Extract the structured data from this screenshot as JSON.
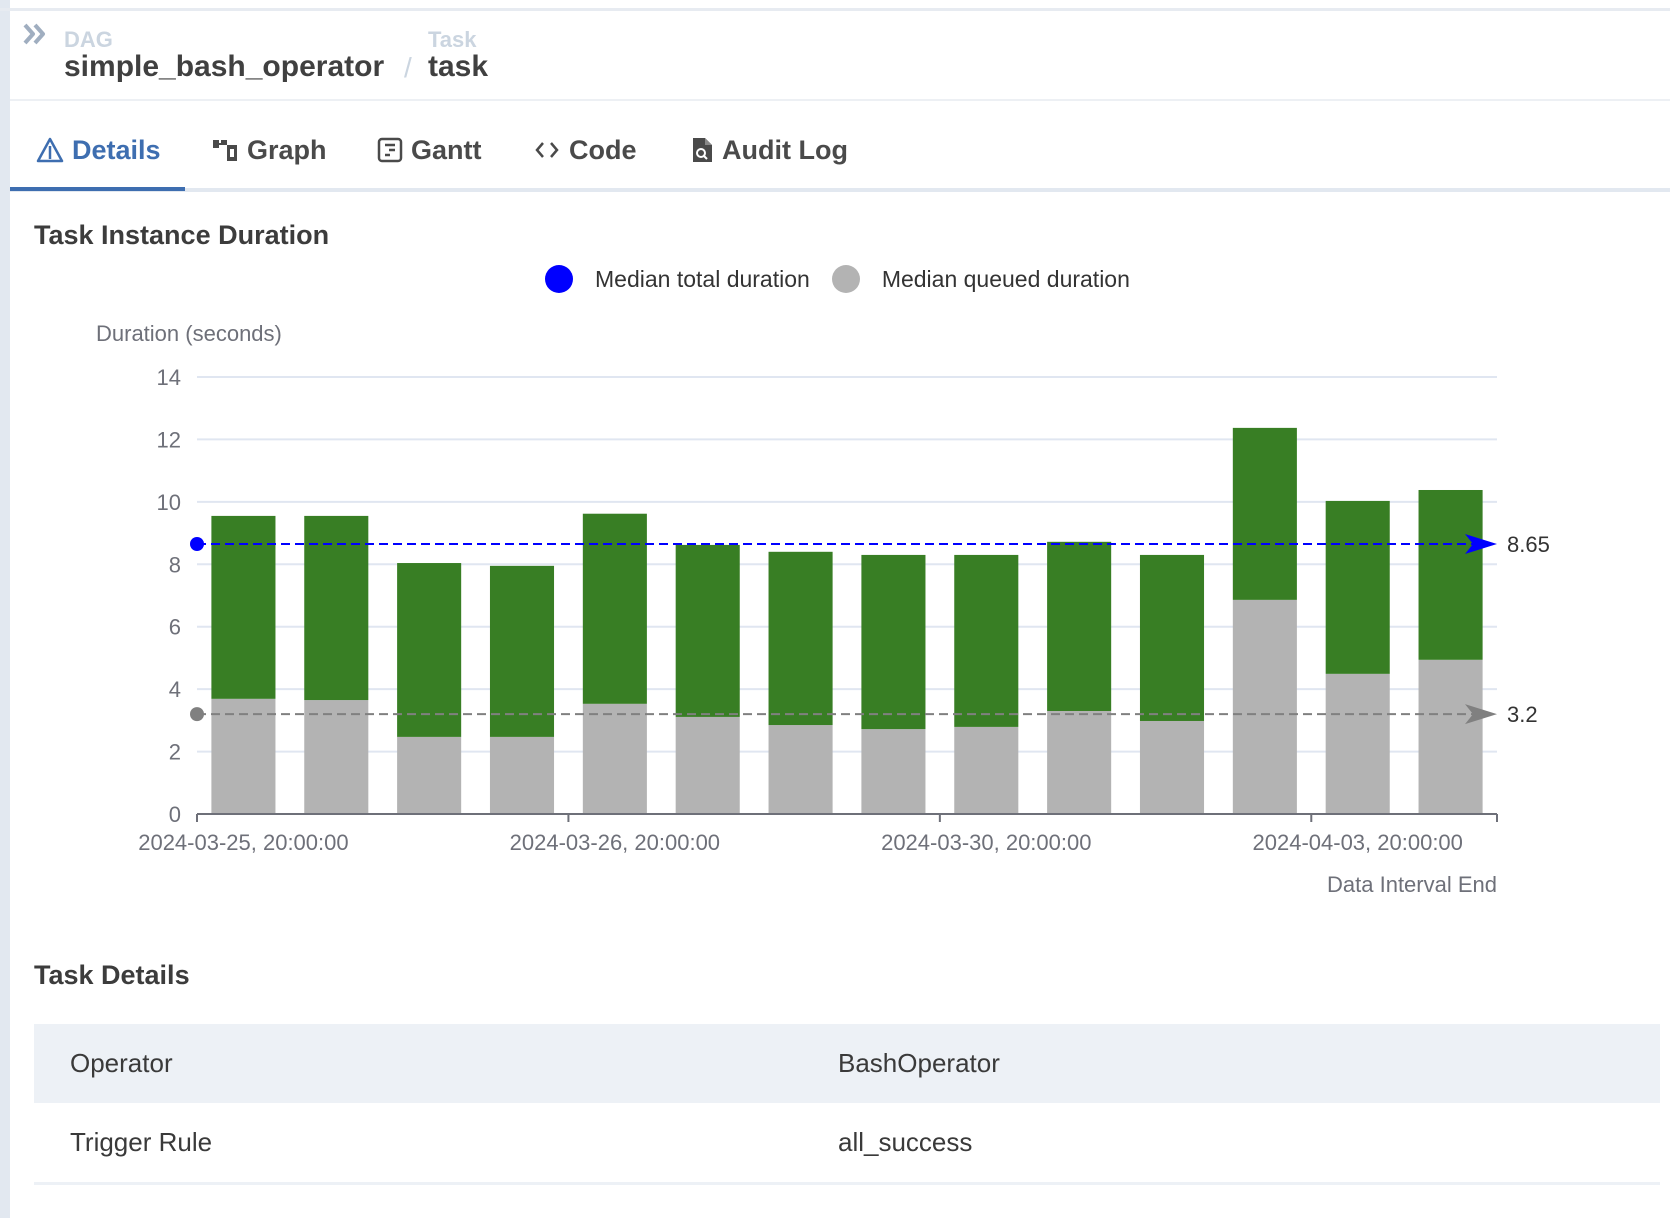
{
  "breadcrumb": {
    "dag_label": "DAG",
    "dag_value": "simple_bash_operator",
    "separator": "/",
    "task_label": "Task",
    "task_value": "task",
    "expand_icon": "double-chevron-right-icon"
  },
  "tabs": [
    {
      "label": "Details",
      "icon": "warning-triangle-icon",
      "active": true
    },
    {
      "label": "Graph",
      "icon": "graph-icon",
      "active": false
    },
    {
      "label": "Gantt",
      "icon": "gantt-icon",
      "active": false
    },
    {
      "label": "Code",
      "icon": "code-icon",
      "active": false
    },
    {
      "label": "Audit Log",
      "icon": "audit-log-icon",
      "active": false
    }
  ],
  "colors": {
    "accent": "#3e6eb0",
    "success_bar": "#387e24",
    "queued_bar": "#b3b3b3",
    "median_total": "#0000ff",
    "median_queued": "#808080"
  },
  "chart_data": {
    "type": "bar",
    "stacked": true,
    "title": "Task Instance Duration",
    "ylabel": "Duration (seconds)",
    "xlabel": "Data Interval End",
    "ylim": [
      0,
      14
    ],
    "yticks": [
      0,
      2,
      4,
      6,
      8,
      10,
      12,
      14
    ],
    "grid": true,
    "legend_position": "top-center",
    "legend": [
      {
        "name": "Median total duration",
        "color": "#0000ff"
      },
      {
        "name": "Median queued duration",
        "color": "#b3b3b3"
      }
    ],
    "xtick_labels": [
      {
        "index": 0,
        "label": "2024-03-25, 20:00:00"
      },
      {
        "index": 4,
        "label": "2024-03-26, 20:00:00"
      },
      {
        "index": 8,
        "label": "2024-03-30, 20:00:00"
      },
      {
        "index": 12,
        "label": "2024-04-03, 20:00:00"
      }
    ],
    "bar_count": 14,
    "series": [
      {
        "name": "Queued duration",
        "color": "#b3b3b3",
        "values": [
          3.69,
          3.65,
          2.47,
          2.47,
          3.53,
          3.11,
          2.85,
          2.72,
          2.79,
          3.3,
          2.98,
          6.86,
          4.49,
          4.94
        ]
      },
      {
        "name": "Run duration",
        "color": "#387e24",
        "values": [
          5.86,
          5.9,
          5.57,
          5.48,
          6.09,
          5.51,
          5.55,
          5.58,
          5.51,
          5.42,
          5.32,
          5.51,
          5.54,
          5.44
        ]
      }
    ],
    "total_durations": [
      9.55,
      9.55,
      8.04,
      7.95,
      9.62,
      8.62,
      8.4,
      8.3,
      8.3,
      8.72,
      8.3,
      12.37,
      10.03,
      10.38
    ],
    "markers": [
      {
        "name": "Median total duration",
        "value": 8.65,
        "label": "8.65",
        "color": "#0000ff"
      },
      {
        "name": "Median queued duration",
        "value": 3.2,
        "label": "3.2",
        "color": "#808080"
      }
    ]
  },
  "task_details": {
    "title": "Task Details",
    "rows": [
      {
        "key": "Operator",
        "value": "BashOperator"
      },
      {
        "key": "Trigger Rule",
        "value": "all_success"
      }
    ]
  }
}
